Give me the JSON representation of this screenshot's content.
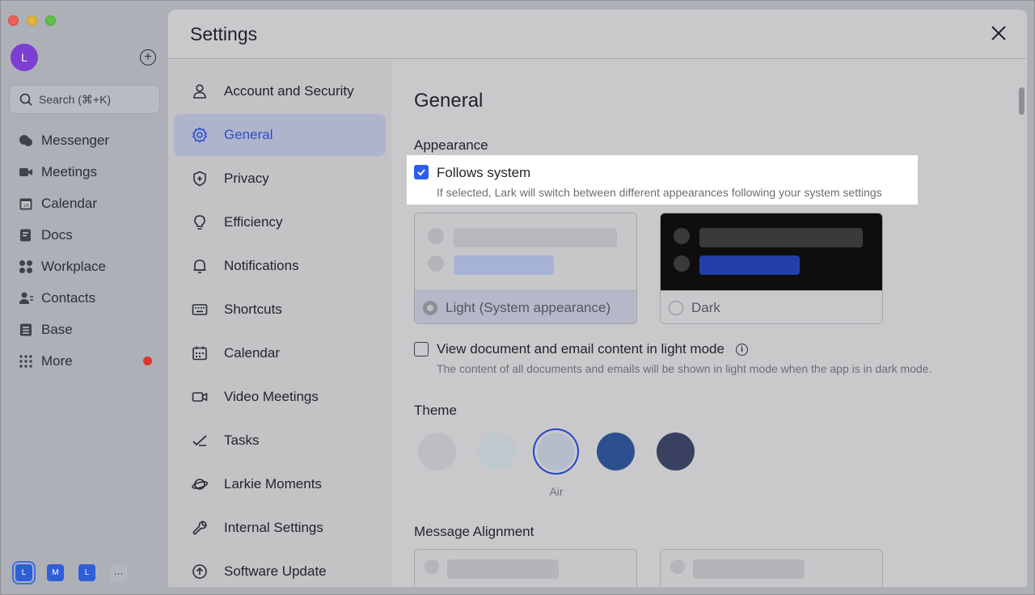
{
  "sidebar": {
    "avatar_letter": "L",
    "search_placeholder": "Search (⌘+K)",
    "items": [
      {
        "label": "Messenger",
        "icon": "messenger-icon"
      },
      {
        "label": "Meetings",
        "icon": "video-camera-icon"
      },
      {
        "label": "Calendar",
        "icon": "calendar-icon"
      },
      {
        "label": "Docs",
        "icon": "docs-icon"
      },
      {
        "label": "Workplace",
        "icon": "grid-icon"
      },
      {
        "label": "Contacts",
        "icon": "contacts-icon"
      },
      {
        "label": "Base",
        "icon": "base-icon"
      },
      {
        "label": "More",
        "icon": "more-dots-icon"
      }
    ],
    "accounts": [
      "L",
      "M",
      "L",
      "···"
    ]
  },
  "dialog": {
    "title": "Settings",
    "menu": [
      {
        "label": "Account and Security",
        "icon": "person-icon"
      },
      {
        "label": "General",
        "icon": "gear-icon"
      },
      {
        "label": "Privacy",
        "icon": "shield-icon"
      },
      {
        "label": "Efficiency",
        "icon": "lightbulb-icon"
      },
      {
        "label": "Notifications",
        "icon": "bell-icon"
      },
      {
        "label": "Shortcuts",
        "icon": "keyboard-icon"
      },
      {
        "label": "Calendar",
        "icon": "calendar-icon"
      },
      {
        "label": "Video Meetings",
        "icon": "video-icon"
      },
      {
        "label": "Tasks",
        "icon": "tasks-icon"
      },
      {
        "label": "Larkie Moments",
        "icon": "planet-icon"
      },
      {
        "label": "Internal Settings",
        "icon": "wrench-icon"
      },
      {
        "label": "Software Update",
        "icon": "update-icon"
      }
    ],
    "selected": "General"
  },
  "general": {
    "heading": "General",
    "appearance": {
      "heading": "Appearance",
      "follows_label": "Follows system",
      "follows_desc": "If selected, Lark will switch between different appearances following your system settings",
      "follows_checked": true,
      "light_label": "Light (System appearance)",
      "dark_label": "Dark",
      "light_selected": true
    },
    "light_mode_docs": {
      "label": "View document and email content in light mode",
      "desc": "The content of all documents and emails will be shown in light mode when the app is in dark mode.",
      "checked": false
    },
    "theme": {
      "heading": "Theme",
      "swatches": [
        "#bdbec2",
        "#bfc8cc",
        "#b7bcca",
        "#2e4f8f",
        "#3a4060"
      ],
      "selected_label": "Air"
    },
    "message_alignment": {
      "heading": "Message Alignment"
    }
  },
  "colors": {
    "accent": "#2d5cf0",
    "notification_dot": "#e0332f"
  }
}
